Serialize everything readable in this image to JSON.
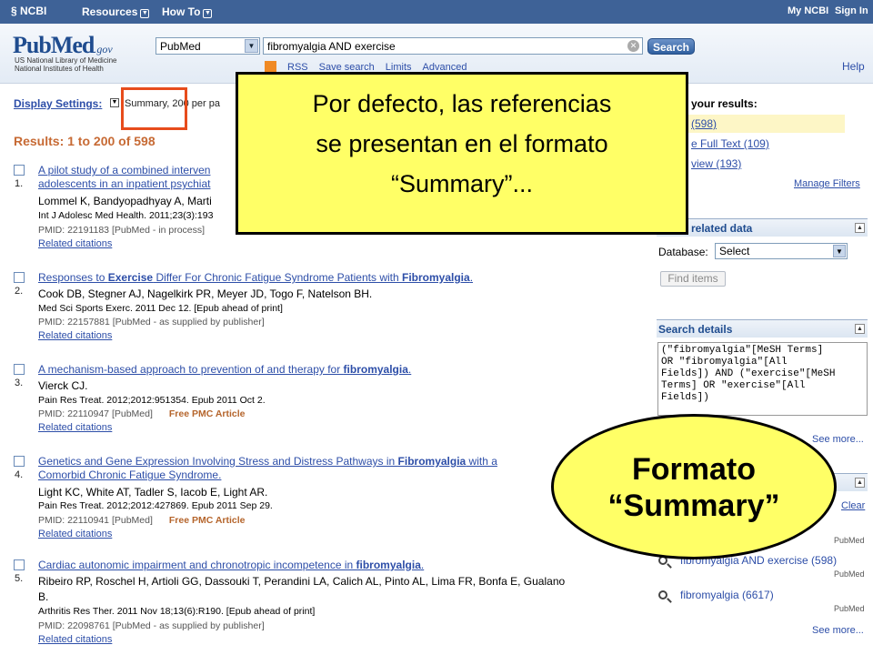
{
  "topnav": {
    "logo": "NCBI",
    "resources": "Resources",
    "howto": "How To",
    "myncbi": "My NCBI",
    "signin": "Sign In"
  },
  "header": {
    "brand_pub": "Pub",
    "brand_med": "Med",
    "brand_gov": ".gov",
    "nlm_line1": "US National Library of Medicine",
    "nlm_line2": "National Institutes of Health",
    "database": "PubMed",
    "query": "fibromyalgia AND exercise",
    "search_button": "Search",
    "links": [
      "RSS",
      "Save search",
      "Limits",
      "Advanced"
    ],
    "help": "Help"
  },
  "display": {
    "label": "Display Settings:",
    "value": "Summary, 200 per pa"
  },
  "results_heading": "Results: 1 to 200 of 598",
  "results": [
    {
      "num": "1.",
      "title_lines": [
        "A pilot study of a combined interven",
        "adolescents in an inpatient psychiat"
      ],
      "authors": "Lommel K, Bandyopadhyay A, Marti",
      "journal": "Int J Adolesc Med Health. 2011;23(3):193",
      "pmid": "PMID: 22191183 [PubMed - in process]",
      "free": "",
      "related": "Related citations"
    },
    {
      "num": "2.",
      "title_pre": "Responses to ",
      "title_b1": "Exercise",
      "title_mid": " Differ For Chronic Fatigue Syndrome Patients with ",
      "title_b2": "Fibromyalgia",
      "title_post": ".",
      "authors": "Cook DB, Stegner AJ, Nagelkirk PR, Meyer JD, Togo F, Natelson BH.",
      "journal": "Med Sci Sports Exerc. 2011 Dec 12. [Epub ahead of print]",
      "pmid": "PMID: 22157881 [PubMed - as supplied by publisher]",
      "related": "Related citations"
    },
    {
      "num": "3.",
      "title_pre": "A mechanism-based approach to prevention of and therapy for ",
      "title_b1": "fibromyalgia",
      "title_post": ".",
      "authors": "Vierck CJ.",
      "journal": "Pain Res Treat. 2012;2012:951354. Epub 2011 Oct 2.",
      "pmid": "PMID: 22110947 [PubMed]",
      "free": "Free PMC Article",
      "related": "Related citations"
    },
    {
      "num": "4.",
      "title_pre": "Genetics and Gene Expression Involving Stress and Distress Pathways in ",
      "title_b1": "Fibromyalgia",
      "title_post": " with a",
      "title_line2": "Comorbid Chronic Fatigue Syndrome.",
      "authors": "Light KC, White AT, Tadler S, Iacob E, Light AR.",
      "journal": "Pain Res Treat. 2012;2012:427869. Epub 2011 Sep 29.",
      "pmid": "PMID: 22110941 [PubMed]",
      "free": "Free PMC Article",
      "related": "Related citations"
    },
    {
      "num": "5.",
      "title_pre": "Cardiac autonomic impairment and chronotropic incompetence in ",
      "title_b1": "fibromyalgia",
      "title_post": ".",
      "authors": "Ribeiro RP, Roschel H, Artioli GG, Dassouki T, Perandini LA, Calich AL, Pinto AL, Lima FR, Bonfa E, Gualano",
      "authors2": "B.",
      "journal": "Arthritis Res Ther. 2011 Nov 18;13(6):R190. [Epub ahead of print]",
      "pmid": "PMID: 22098761 [PubMed - as supplied by publisher]",
      "related": "Related citations"
    }
  ],
  "sidebar": {
    "filter_title": "your results:",
    "filters": [
      "(598)",
      "e Full Text (109)",
      "view (193)"
    ],
    "manage_filters": "Manage Filters",
    "related_title": "related data",
    "db_label": "Database:",
    "db_select": "Select",
    "find_items": "Find items",
    "search_details_title": "Search details",
    "search_details": "(\"fibromyalgia\"[MeSH Terms]\nOR \"fibromyalgia\"[All\nFields]) AND (\"exercise\"[MeSH\nTerms] OR \"exercise\"[All\nFields])",
    "see_more": "See more...",
    "clear": "Clear",
    "history": [
      {
        "text": "fibromyalgia AND exercise (598)",
        "source": "PubMed"
      },
      {
        "text": "fibromyalgia (6617)",
        "source": "PubMed"
      }
    ],
    "history_top_source": "PubMed"
  },
  "overlay": {
    "callout_lines": [
      "Por defecto, las referencias",
      "se presentan en el formato",
      "“Summary”..."
    ],
    "oval_lines": [
      "Formato",
      "“Summary”"
    ]
  }
}
